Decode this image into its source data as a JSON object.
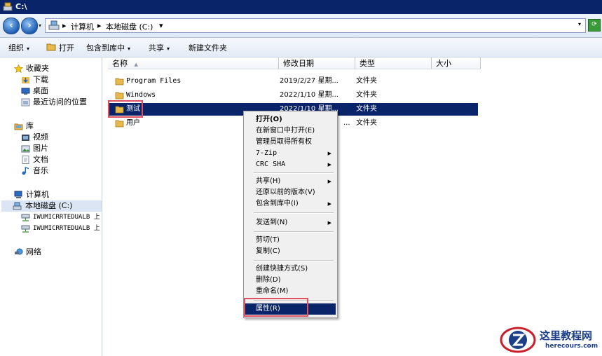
{
  "window": {
    "title": "C:\\"
  },
  "address": {
    "crumbs": [
      "计算机",
      "本地磁盘 (C:)"
    ],
    "separator": "▸",
    "dropdown": "▾"
  },
  "toolbar": {
    "organize": "组织",
    "open": "打开",
    "include_in_library": "包含到库中",
    "share": "共享",
    "new_folder": "新建文件夹",
    "dropdown": "▾"
  },
  "nav": {
    "favorites": "收藏夹",
    "downloads": "下载",
    "desktop": "桌面",
    "recent": "最近访问的位置",
    "libraries": "库",
    "videos": "视频",
    "pictures": "图片",
    "documents": "文档",
    "music": "音乐",
    "computer": "计算机",
    "local_disk": "本地磁盘 (C:)",
    "net_drive_1": "IWUMICRRTEDUALB 上",
    "net_drive_2": "IWUMICRRTEDUALB 上",
    "network": "网络"
  },
  "columns": {
    "name": "名称",
    "sort_indicator": "▲",
    "modified": "修改日期",
    "type": "类型",
    "size": "大小"
  },
  "files": [
    {
      "name": "Program Files",
      "date": "2019/2/27 星期...",
      "type": "文件夹"
    },
    {
      "name": "Windows",
      "date": "2022/1/10 星期...",
      "type": "文件夹"
    },
    {
      "name": "测试",
      "date": "2022/1/10 星期...",
      "type": "文件夹"
    },
    {
      "name": "用户",
      "date": "...",
      "type": "文件夹"
    }
  ],
  "context_menu": {
    "open": "打开(O)",
    "open_new_window": "在新窗口中打开(E)",
    "take_ownership": "管理员取得所有权",
    "zip": "7-Zip",
    "crc": "CRC SHA",
    "share": "共享(H)",
    "restore": "还原以前的版本(V)",
    "include_library": "包含到库中(I)",
    "send_to": "发送到(N)",
    "cut": "剪切(T)",
    "copy": "复制(C)",
    "create_shortcut": "创建快捷方式(S)",
    "delete": "删除(D)",
    "rename": "重命名(M)",
    "properties": "属性(R)",
    "submenu_arrow": "▶"
  },
  "watermark": {
    "name_cn": "这里教程网",
    "url": "herecours.com"
  },
  "colors": {
    "selection": "#0a246a",
    "highlight_box": "#e05060",
    "folder": "#e8b84a",
    "watermark": "#1d3f88"
  }
}
